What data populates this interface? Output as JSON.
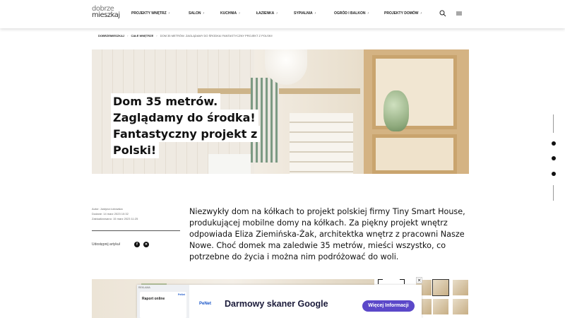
{
  "header": {
    "logo_line1": "dobrze",
    "logo_line2": "mieszkaj",
    "nav": [
      {
        "label": "PROJEKTY WNĘTRZ"
      },
      {
        "label": "SALON"
      },
      {
        "label": "KUCHNIA"
      },
      {
        "label": "ŁAZIENKA"
      },
      {
        "label": "SYPIALNIA"
      },
      {
        "label": "OGRÓD I BALKON"
      },
      {
        "label": "PROJEKTY DOMÓW"
      }
    ],
    "chevron": "›",
    "search_icon": "search-icon",
    "menu_icon": "hamburger-icon"
  },
  "breadcrumb": {
    "items": [
      "DOBRZEMIESZKAJ",
      "CAŁE WNĘTRZE",
      "DOM 35 METRÓW. ZAGLĄDAMY DO ŚRODKA! FANTASTYCZNY PROJEKT Z POLSKI!"
    ],
    "separator": "›"
  },
  "hero": {
    "title_lines": [
      "Dom 35 metrów.",
      "Zaglądamy do środka!",
      "Fantastyczny projekt z",
      "Polski!"
    ]
  },
  "meta": {
    "author": "Autor: Justyna Łotowska",
    "added": "Dodane: 14 marz 2023 10:32",
    "updated": "Zaktualizowano: 15 marz 2023 11:25",
    "share_label": "Udostępnij artykuł",
    "share_icons": [
      "facebook-icon",
      "x-icon"
    ]
  },
  "lead": "Niezwykły dom na kółkach to projekt polskiej firmy Tiny Smart House, produkującej mobilne domy na kółkach. Za piękny projekt wnętrz odpowiada Eliza Ziemińska-Żak, architektka wnętrz z pracowni Nasze Nowe. Choć domek ma zaledwie 35 metrów, mieści wszystko, co potrzebne do życia i można nim podróżować do woli.",
  "floating_social": [
    "facebook-icon",
    "pinterest-icon",
    "pinterest-icon"
  ],
  "ad": {
    "mini_tag": "REKLAMA",
    "mini_title": "Raport online",
    "mini_brand": "PeNet",
    "logo": "PeNet",
    "headline": "Darmowy skaner Google",
    "cta": "Więcej Informacji",
    "close": "✕"
  }
}
